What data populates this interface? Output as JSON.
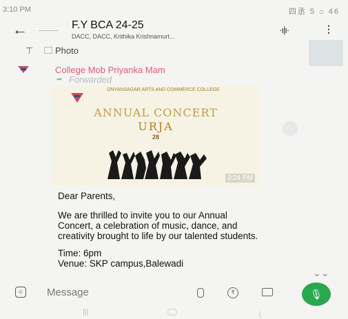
{
  "status_bar": {
    "time": "3:10 PM",
    "right_icons": "四丞 5 ⌂ 46"
  },
  "header": {
    "title": "F.Y BCA 24-25",
    "subtitle": "DACC, DACC, Krithika Krishnamurt...",
    "back_icon": "arrow-left-icon",
    "voice_icon": "voice-call-icon",
    "menu_icon": "more-vertical-icon"
  },
  "pinned": {
    "label": "Photo"
  },
  "message": {
    "sender": "College Mob Priyanka Mam",
    "forwarded": "Forwarded",
    "poster": {
      "college": "DNYANSAGAR ARTS AND COMMERCE COLLEGE",
      "title": "ANNUAL CONCERT",
      "subtitle": "URJA",
      "date": "28"
    },
    "timestamp": "3:24 PM",
    "greeting": "Dear Parents,",
    "body": "We are thrilled to invite you to our Annual Concert, a celebration of music, dance, and creativity brought to life by our talented students.",
    "time_line": "Time: 6pm",
    "venue_line": "Venue: SKP campus,Balewadi"
  },
  "input": {
    "placeholder": "Message"
  },
  "colors": {
    "sender": "#e05a74",
    "mic": "#2aa84f",
    "poster_gold": "#b57d24"
  }
}
